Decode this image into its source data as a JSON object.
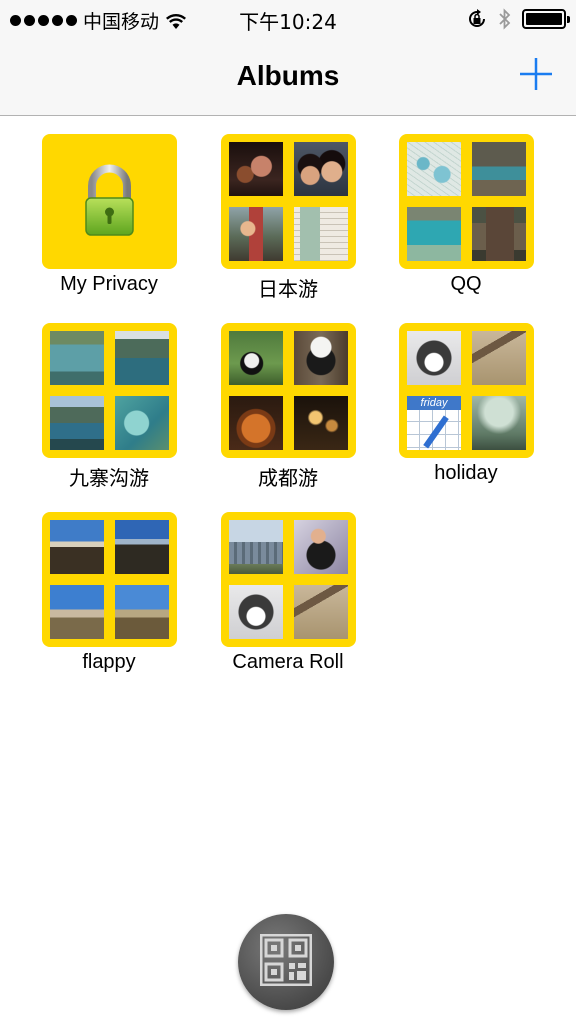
{
  "status_bar": {
    "carrier": "中国移动",
    "time": "下午10:24",
    "icons": [
      "signal-dots",
      "wifi-icon",
      "rotation-lock-icon",
      "bluetooth-icon",
      "battery-icon"
    ]
  },
  "nav": {
    "title": "Albums",
    "add_icon": "plus-icon",
    "accent_color": "#1a7cf0"
  },
  "albums": [
    {
      "name": "My Privacy",
      "icon": "lock-icon"
    },
    {
      "name": "日本游",
      "thumbnails": [
        "night-group-photo",
        "selfie-photo",
        "tourist-photo",
        "document-photo"
      ]
    },
    {
      "name": "QQ",
      "thumbnails": [
        "map-photo",
        "lake-trees-photo",
        "turquoise-lake-photo",
        "signboard-photo"
      ]
    },
    {
      "name": "九寨沟游",
      "thumbnails": [
        "lake-photo",
        "mountain-lake-photo",
        "mountain-reflection-photo",
        "turquoise-water-photo"
      ]
    },
    {
      "name": "成都游",
      "thumbnails": [
        "panda-photo",
        "panda-tree-photo",
        "hotpot-photo",
        "night-street-photo"
      ]
    },
    {
      "name": "holiday",
      "thumbnails": [
        "husky-puppy-photo",
        "dragon-sculpture-photo",
        "calendar-friday-icon",
        "foggy-landscape-photo"
      ]
    },
    {
      "name": "flappy",
      "thumbnails": [
        "plateau-photo",
        "mountains-photo",
        "prairie-photo",
        "highland-photo"
      ]
    },
    {
      "name": "Camera Roll",
      "thumbnails": [
        "city-skyline-photo",
        "woman-portrait-photo",
        "husky-puppy-photo",
        "dragon-sculpture-photo"
      ]
    }
  ],
  "calendar_label": "friday",
  "tile_color": "#ffd800",
  "bottom_button": {
    "icon": "qr-code-icon"
  }
}
